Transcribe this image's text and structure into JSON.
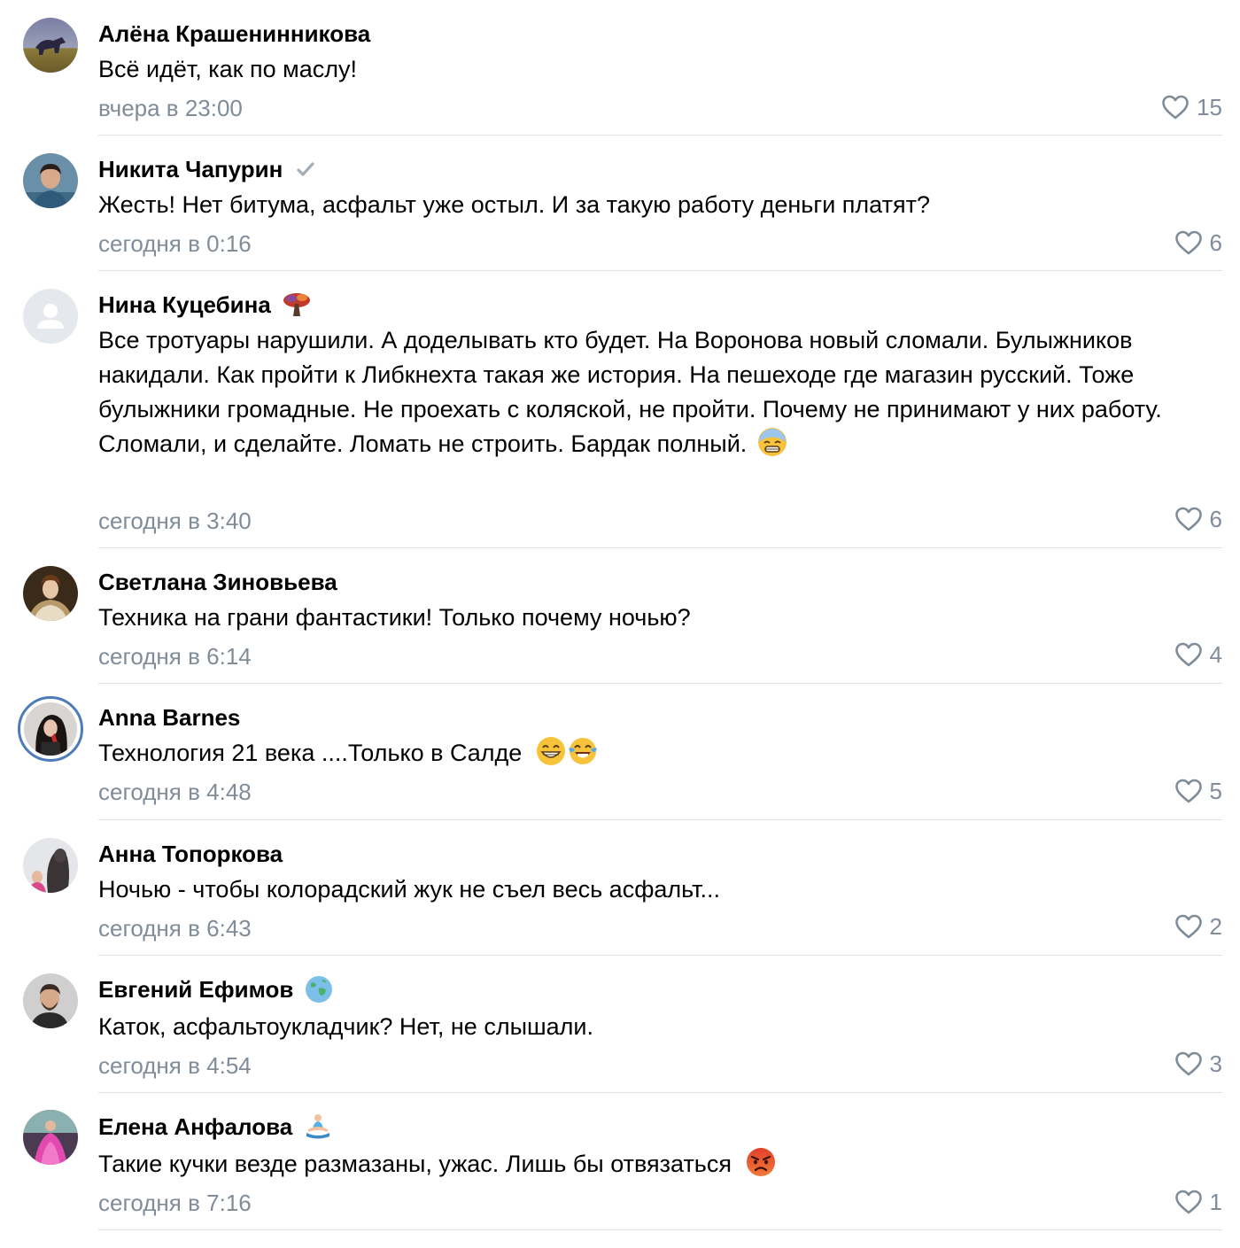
{
  "colors": {
    "text": "#000000",
    "secondary": "#818c99",
    "divider": "#e1e3e6",
    "story_ring": "#4f7bb9"
  },
  "comments": [
    {
      "author": "Алёна Крашенинникова",
      "avatar": "horse-photo-avatar",
      "text": "Всё идёт, как по маслу!",
      "date": "вчера в 23:00",
      "likes": "15"
    },
    {
      "author": "Никита Чапурин",
      "avatar": "man-photo-avatar",
      "badge": "checkmark-icon",
      "text": "Жесть! Нет битума, асфальт уже остыл. И за такую работу деньги платят?",
      "date": "сегодня в 0:16",
      "likes": "6"
    },
    {
      "author": "Нина Куцебина",
      "avatar": "default-user-avatar",
      "badge": "tree-icon",
      "text": "Все тротуары нарушили. А доделывать кто будет. На Воронова новый сломали. Булыжников накидали. Как пройти к Либкнехта такая же история. На пешеходе где магазин русский. Тоже булыжники громадные. Не проехать с коляской, не пройти. Почему не принимают у них работу. Сломали, и сделайте. Ломать не строить. Бардак полный.",
      "emoji": "anxious-face-emoji",
      "date": "сегодня в 3:40",
      "likes": "6"
    },
    {
      "author": "Светлана Зиновьева",
      "avatar": "painting-portrait-avatar",
      "text": "Техника на грани фантастики! Только почему ночью?",
      "date": "сегодня в 6:14",
      "likes": "4"
    },
    {
      "author": "Anna Barnes",
      "avatar": "woman-photo-avatar",
      "text": "Технология 21 века ....Только в Салде",
      "emoji": "grinning-face-emoji",
      "emoji2": "tears-of-joy-emoji",
      "date": "сегодня в 4:48",
      "likes": "5"
    },
    {
      "author": "Анна Топоркова",
      "avatar": "statue-photo-avatar",
      "text": "Ночью - чтобы колорадский жук не съел весь асфальт...",
      "date": "сегодня в 6:43",
      "likes": "2"
    },
    {
      "author": "Евгений Ефимов",
      "avatar": "man-beard-photo-avatar",
      "badge": "globe-icon",
      "text": "Каток, асфальтоукладчик? Нет, не слышали.",
      "date": "сегодня в 4:54",
      "likes": "3"
    },
    {
      "author": "Елена Анфалова",
      "avatar": "pink-dress-photo-avatar",
      "badge": "meditation-icon",
      "text": "Такие кучки везде размазаны, ужас. Лишь бы отвязаться",
      "emoji": "angry-face-emoji",
      "date": "сегодня в 7:16",
      "likes": "1"
    }
  ]
}
